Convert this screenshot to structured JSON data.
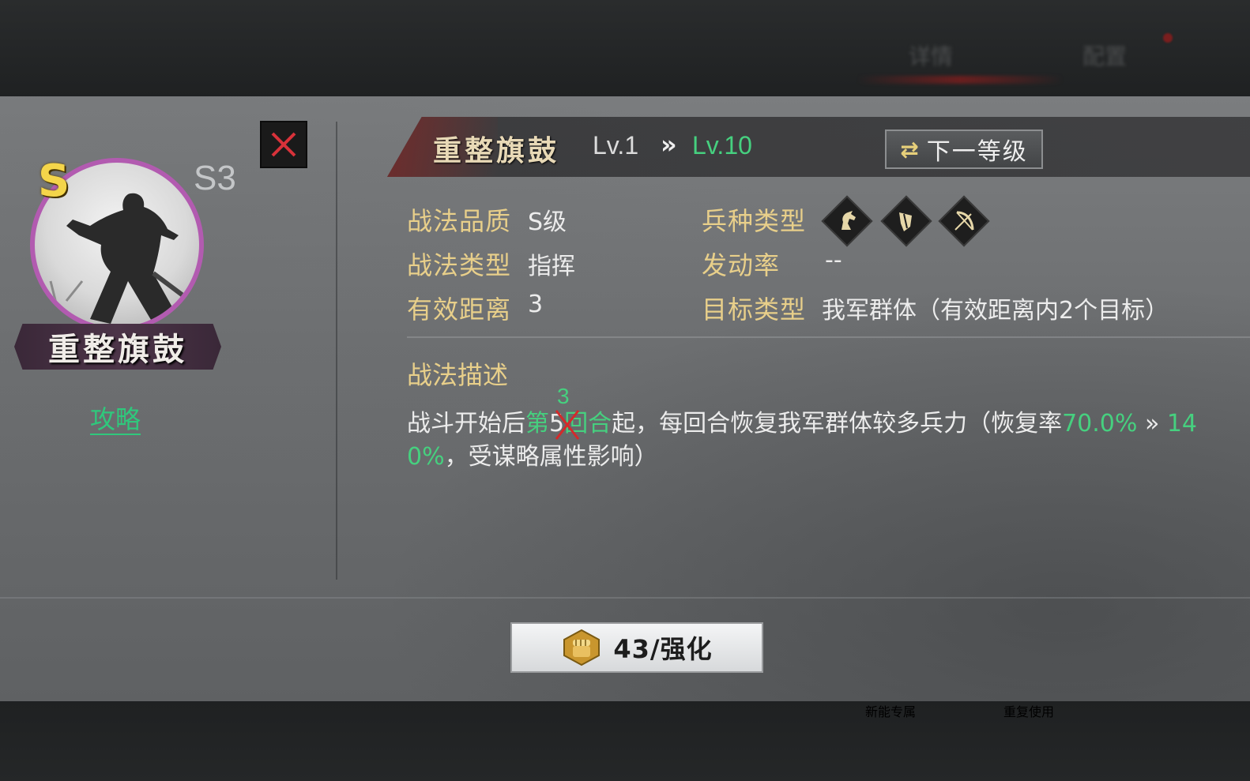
{
  "background": {
    "tab_detail": "详情",
    "tab_other": "配置",
    "bottom_text_1": "新能专属",
    "bottom_text_2": "重复使用"
  },
  "left": {
    "grade": "S",
    "season": "S3",
    "name": "重整旗鼓",
    "guide_link": "攻略"
  },
  "header": {
    "title": "重整旗鼓",
    "level_current": "Lv.1",
    "level_arrow": "»",
    "level_max": "Lv.10",
    "next_level_button": "下一等级"
  },
  "attributes": {
    "quality_label": "战法品质",
    "quality_value": "S级",
    "type_label": "战法类型",
    "type_value": "指挥",
    "range_label": "有效距离",
    "range_value": "3",
    "troop_label": "兵种类型",
    "troop_icons": [
      "cavalry-icon",
      "shield-icon",
      "bow-icon"
    ],
    "trigger_label": "发动率",
    "trigger_value": "--",
    "target_label": "目标类型",
    "target_value": "我军群体（有效距离内2个目标）"
  },
  "description": {
    "heading": "战法描述",
    "seg1": "战斗开始后",
    "seg2_green": "第",
    "seg3_crossed": "5",
    "seg4_green": "回合",
    "seg5": "起，每回合恢复我军群体较多兵力（恢复率",
    "seg6_green": "70.0%",
    "seg7": " » ",
    "seg8_green": "14",
    "line2_green": "0%",
    "line2_rest": "，受谋略属性影响）",
    "correction": "3"
  },
  "upgrade": {
    "label": "43/强化",
    "icon": "fist-icon"
  },
  "colors": {
    "accent_green": "#46d07f",
    "label_gold": "#e8cf8a",
    "portrait_border": "#b25bb0",
    "grade_yellow": "#f4d54a"
  }
}
